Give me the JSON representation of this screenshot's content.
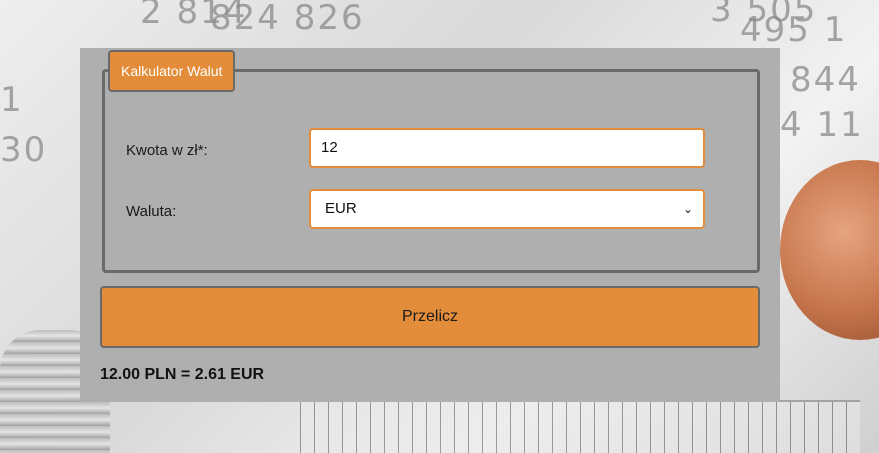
{
  "calculator": {
    "legend": "Kalkulator Walut",
    "amount_label": "Kwota w zł*:",
    "amount_value": "12",
    "currency_label": "Waluta:",
    "currency_selected": "EUR",
    "convert_button": "Przelicz",
    "result_text": "12.00 PLN = 2.61 EUR"
  },
  "colors": {
    "accent": "#e38c3a",
    "panel": "#b0afaf",
    "border": "#6a6a6a"
  }
}
